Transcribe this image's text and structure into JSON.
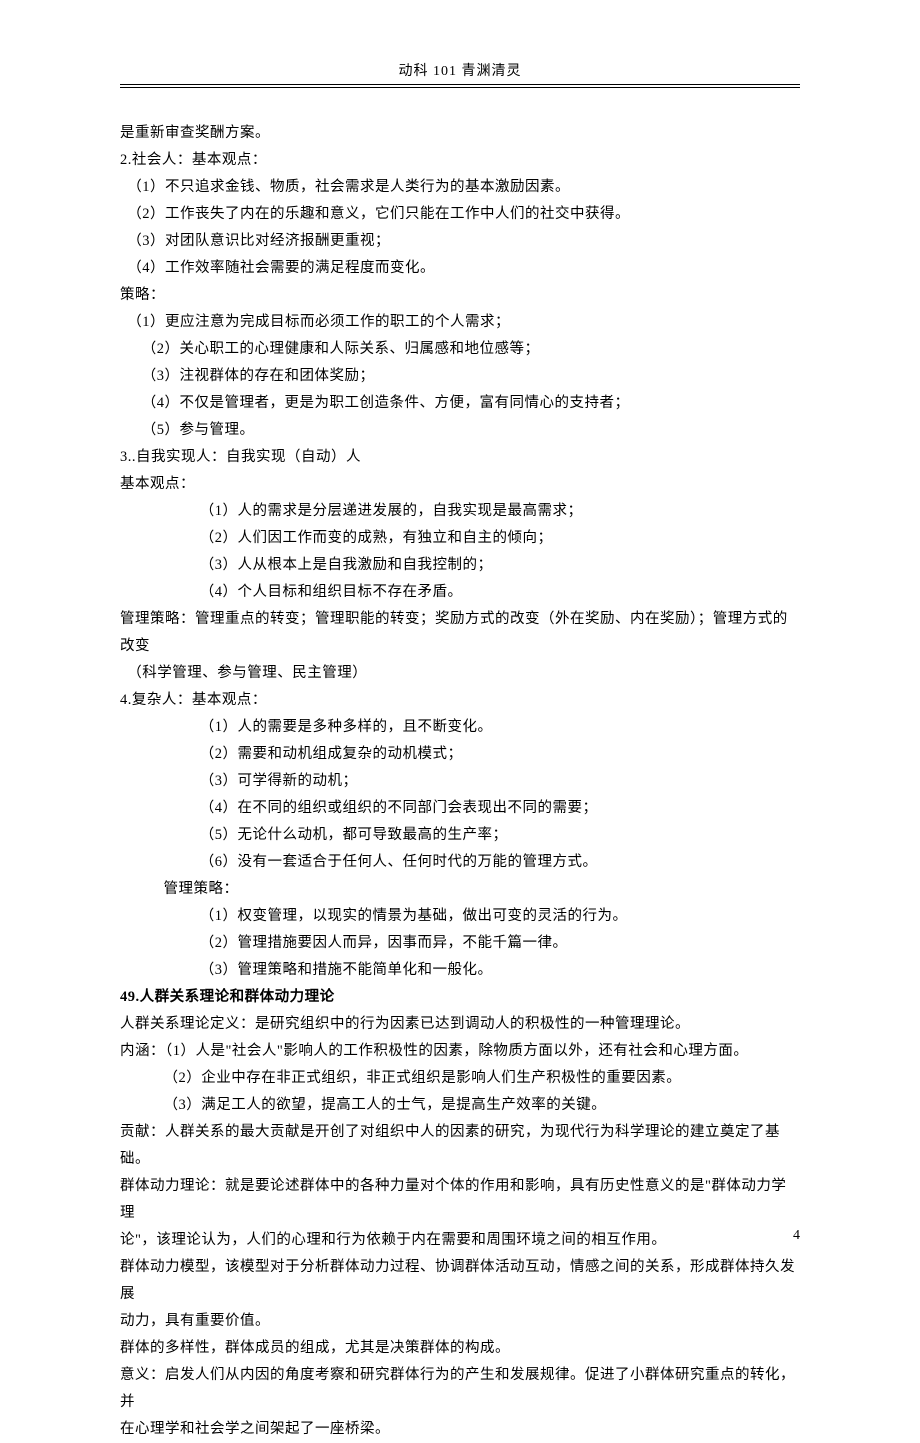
{
  "header": "动科 101 青渊清灵",
  "pageNumber": "4",
  "lines": [
    {
      "cls": "",
      "t": "是重新审查奖酬方案。"
    },
    {
      "cls": "",
      "t": "2.社会人：基本观点："
    },
    {
      "cls": "indent1",
      "t": "（1）不只追求金钱、物质，社会需求是人类行为的基本激励因素。"
    },
    {
      "cls": "indent1",
      "t": "（2）工作丧失了内在的乐趣和意义，它们只能在工作中人们的社交中获得。"
    },
    {
      "cls": "indent1",
      "t": "（3）对团队意识比对经济报酬更重视；"
    },
    {
      "cls": "indent1",
      "t": "（4）工作效率随社会需要的满足程度而变化。"
    },
    {
      "cls": "",
      "t": "策略："
    },
    {
      "cls": "indent1",
      "t": "（1）更应注意为完成目标而必须工作的职工的个人需求；"
    },
    {
      "cls": "indent2",
      "t": "（2）关心职工的心理健康和人际关系、归属感和地位感等；"
    },
    {
      "cls": "indent2",
      "t": "（3）注视群体的存在和团体奖励；"
    },
    {
      "cls": "indent2",
      "t": "（4）不仅是管理者，更是为职工创造条件、方便，富有同情心的支持者；"
    },
    {
      "cls": "indent2",
      "t": "（5）参与管理。"
    },
    {
      "cls": "",
      "t": "3..自我实现人：自我实现（自动）人"
    },
    {
      "cls": "",
      "t": "基本观点："
    },
    {
      "cls": "indent-deep",
      "t": "（1）人的需求是分层递进发展的，自我实现是最高需求；"
    },
    {
      "cls": "indent-deep",
      "t": "（2）人们因工作而变的成熟，有独立和自主的倾向；"
    },
    {
      "cls": "indent-deep",
      "t": "（3）人从根本上是自我激励和自我控制的；"
    },
    {
      "cls": "indent-deep",
      "t": "（4）个人目标和组织目标不存在矛盾。"
    },
    {
      "cls": "",
      "t": "管理策略：管理重点的转变；管理职能的转变；奖励方式的改变（外在奖励、内在奖励）；管理方式的改变"
    },
    {
      "cls": "indent1",
      "t": "（科学管理、参与管理、民主管理）"
    },
    {
      "cls": "",
      "t": "4.复杂人：基本观点："
    },
    {
      "cls": "indent-deep",
      "t": "（1）人的需要是多种多样的，且不断变化。"
    },
    {
      "cls": "indent-deep",
      "t": "（2）需要和动机组成复杂的动机模式；"
    },
    {
      "cls": "indent-deep",
      "t": "（3）可学得新的动机；"
    },
    {
      "cls": "indent-deep",
      "t": "（4）在不同的组织或组织的不同部门会表现出不同的需要；"
    },
    {
      "cls": "indent-deep",
      "t": "（5）无论什么动机，都可导致最高的生产率；"
    },
    {
      "cls": "indent-deep",
      "t": "（6）没有一套适合于任何人、任何时代的万能的管理方式。"
    },
    {
      "cls": "indent-mgmt",
      "t": "管理策略："
    },
    {
      "cls": "indent-deep",
      "t": "（1）权变管理，以现实的情景为基础，做出可变的灵活的行为。"
    },
    {
      "cls": "indent-deep",
      "t": "（2）管理措施要因人而异，因事而异，不能千篇一律。"
    },
    {
      "cls": "indent-deep",
      "t": "（3）管理策略和措施不能简单化和一般化。"
    },
    {
      "cls": "bold",
      "t": "49.人群关系理论和群体动力理论"
    },
    {
      "cls": "",
      "t": "人群关系理论定义：是研究组织中的行为因素已达到调动人的积极性的一种管理理论。"
    },
    {
      "cls": "",
      "t": "内涵：（1）人是\"社会人\"影响人的工作积极性的因素，除物质方面以外，还有社会和心理方面。"
    },
    {
      "cls": "indent-mgmt",
      "t": "（2）企业中存在非正式组织，非正式组织是影响人们生产积极性的重要因素。"
    },
    {
      "cls": "indent-mgmt",
      "t": "（3）满足工人的欲望，提高工人的士气，是提高生产效率的关键。"
    },
    {
      "cls": "",
      "t": "贡献：人群关系的最大贡献是开创了对组织中人的因素的研究，为现代行为科学理论的建立奠定了基础。"
    },
    {
      "cls": "",
      "t": "群体动力理论：就是要论述群体中的各种力量对个体的作用和影响，具有历史性意义的是\"群体动力学理"
    },
    {
      "cls": "",
      "t": "论\"，该理论认为，人们的心理和行为依赖于内在需要和周围环境之间的相互作用。"
    },
    {
      "cls": "",
      "t": "群体动力模型，该模型对于分析群体动力过程、协调群体活动互动，情感之间的关系，形成群体持久发展"
    },
    {
      "cls": "",
      "t": "动力，具有重要价值。"
    },
    {
      "cls": "",
      "t": "群体的多样性，群体成员的组成，尤其是决策群体的构成。"
    },
    {
      "cls": "",
      "t": "意义：启发人们从内因的角度考察和研究群体行为的产生和发展规律。促进了小群体研究重点的转化，并"
    },
    {
      "cls": "",
      "t": "在心理学和社会学之间架起了一座桥梁。"
    }
  ]
}
